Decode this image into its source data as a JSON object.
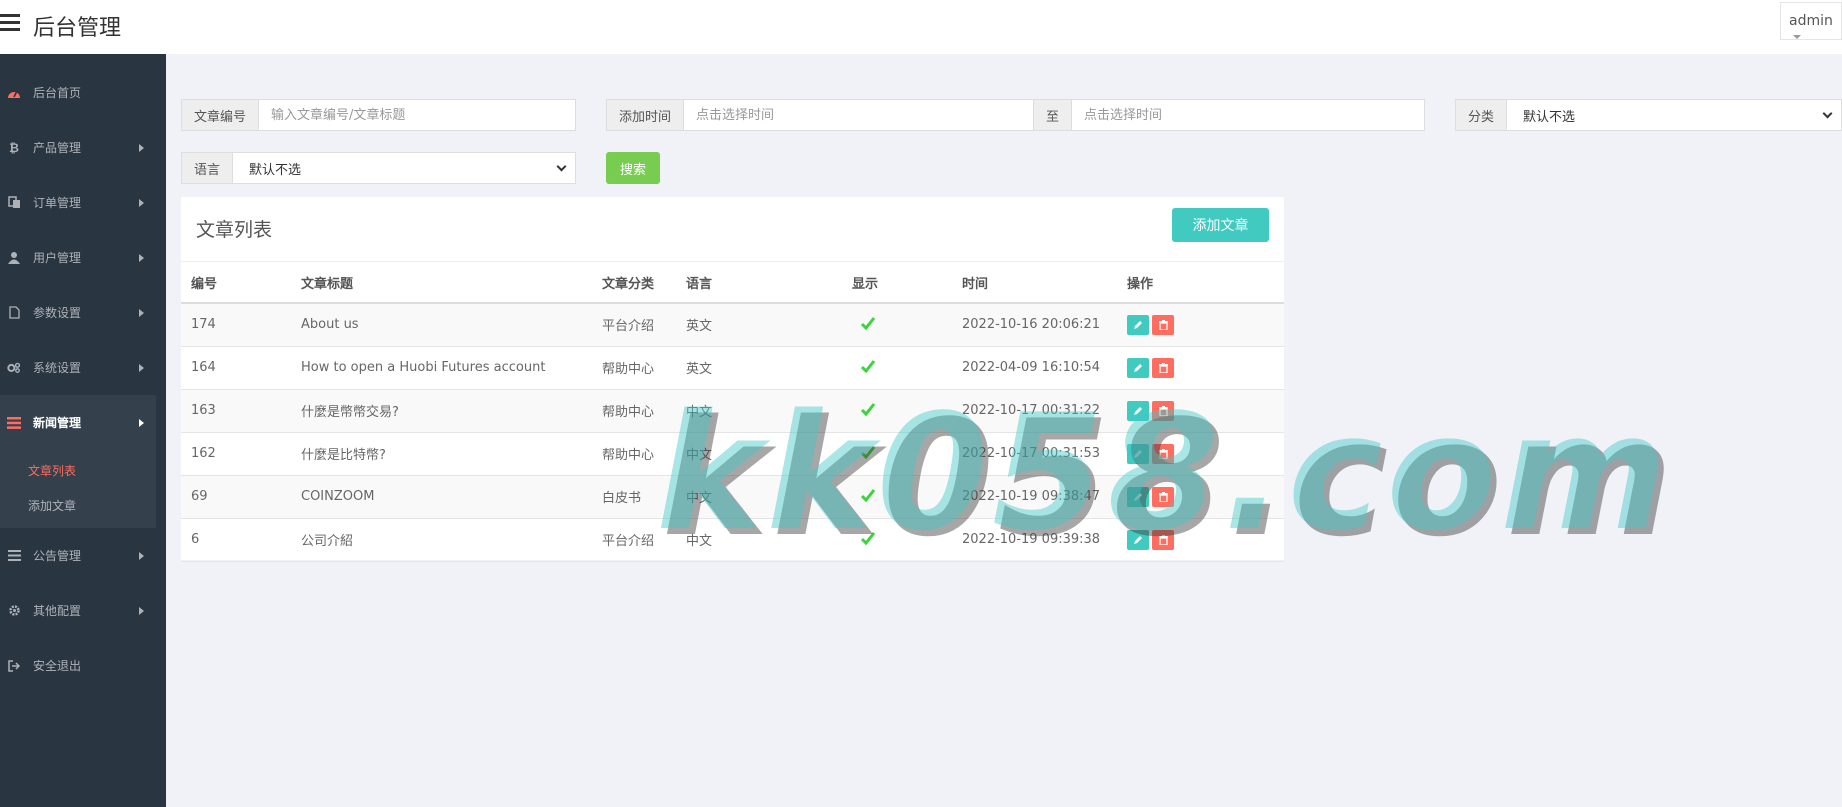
{
  "header": {
    "app_title": "后台管理",
    "user_name": "admin"
  },
  "sidebar": {
    "items": [
      {
        "label": "后台首页",
        "icon": "dashboard-icon"
      },
      {
        "label": "产品管理",
        "icon": "bitcoin-icon"
      },
      {
        "label": "订单管理",
        "icon": "copy-icon"
      },
      {
        "label": "用户管理",
        "icon": "user-icon"
      },
      {
        "label": "参数设置",
        "icon": "file-icon"
      },
      {
        "label": "系统设置",
        "icon": "cogs-icon"
      },
      {
        "label": "新闻管理",
        "icon": "list-icon"
      },
      {
        "label": "公告管理",
        "icon": "list-icon"
      },
      {
        "label": "其他配置",
        "icon": "gear-icon"
      },
      {
        "label": "安全退出",
        "icon": "sign-out-icon"
      }
    ],
    "submenu": [
      {
        "label": "文章列表"
      },
      {
        "label": "添加文章"
      }
    ]
  },
  "filters": {
    "article_no_label": "文章编号",
    "article_no_placeholder": "输入文章编号/文章标题",
    "add_time_label": "添加时间",
    "start_time_placeholder": "点击选择时间",
    "to_label": "至",
    "end_time_placeholder": "点击选择时间",
    "category_label": "分类",
    "category_value": "默认不选",
    "language_label": "语言",
    "language_value": "默认不选",
    "search_label": "搜索"
  },
  "panel": {
    "title": "文章列表",
    "add_button": "添加文章",
    "columns": [
      "编号",
      "文章标题",
      "文章分类",
      "语言",
      "显示",
      "时间",
      "操作"
    ],
    "rows": [
      {
        "id": "174",
        "title": "About us",
        "category": "平台介绍",
        "language": "英文",
        "time": "2022-10-16 20:06:21"
      },
      {
        "id": "164",
        "title": "How to open a Huobi Futures account",
        "category": "帮助中心",
        "language": "英文",
        "time": "2022-04-09 16:10:54"
      },
      {
        "id": "163",
        "title": "什麼是幣幣交易?",
        "category": "帮助中心",
        "language": "中文",
        "time": "2022-10-17 00:31:22"
      },
      {
        "id": "162",
        "title": "什麼是比特幣?",
        "category": "帮助中心",
        "language": "中文",
        "time": "2022-10-17 00:31:53"
      },
      {
        "id": "69",
        "title": "COINZOOM",
        "category": "白皮书",
        "language": "中文",
        "time": "2022-10-19 09:38:47"
      },
      {
        "id": "6",
        "title": "公司介紹",
        "category": "平台介绍",
        "language": "中文",
        "time": "2022-10-19 09:39:38"
      }
    ]
  },
  "watermark": "kk058.com",
  "colors": {
    "sidebar_bg": "#2a3542",
    "accent_red": "#ff6c60",
    "teal": "#41cac0",
    "green": "#78cd51"
  }
}
